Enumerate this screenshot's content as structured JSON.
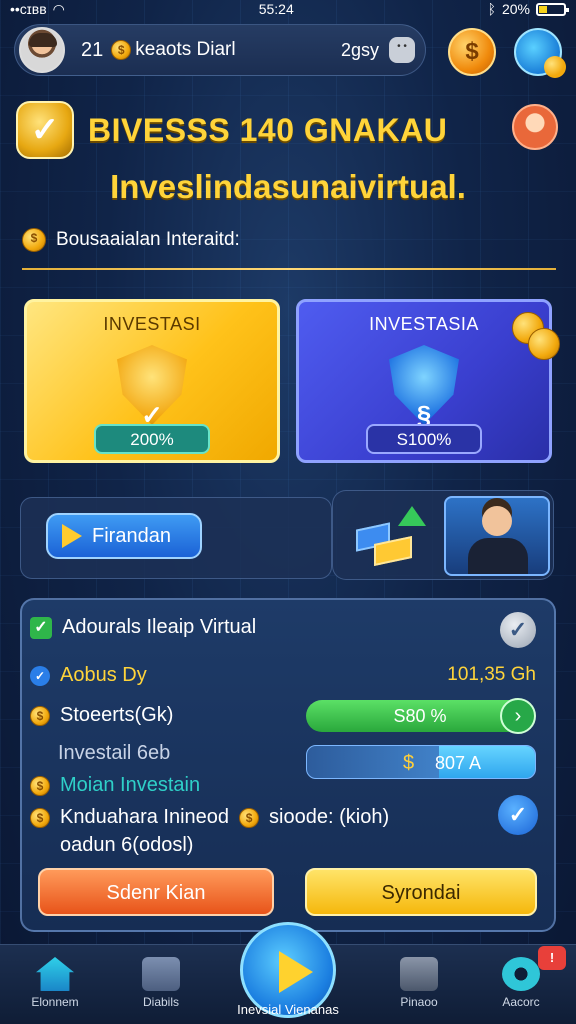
{
  "status_bar": {
    "carrier": "••ᴄɪʙʙ",
    "time": "55:24",
    "battery": "20%"
  },
  "header": {
    "level": "21",
    "name": "keaots Diarl",
    "amount": "2gsy"
  },
  "title": {
    "main": "BIVESSS 140 GNAKAU",
    "subtitle": "Inveslindasunaivirtual."
  },
  "section_label": "Bousaaialan Interaitd:",
  "cards": [
    {
      "title": "INVESTASI",
      "badge": "200%",
      "theme": "yellow"
    },
    {
      "title": "INVESTASIA",
      "badge": "S100%",
      "theme": "blue"
    }
  ],
  "promo": {
    "button_label": "Firandan"
  },
  "portfolio": {
    "header": "Adourals Ileaip Virtual",
    "row1_label": "Aobus Dy",
    "row1_amount": "101,35 Gh",
    "row2_label": "Stoeerts(Gk)",
    "row2_bar": "S80 %",
    "row2_progress": 0.8,
    "row3_label": "Investail 6eb",
    "row3_bar": "807 A",
    "row3_progress": 0.42,
    "row4_label": "Moian Investain",
    "row5_label_a": "Knduahara Inineod",
    "row5_label_b": "sioode: (kioh)",
    "row6_label": "oadun 6(odosl)",
    "btn_left": "Sdenr Kian",
    "btn_right": "Syrondai"
  },
  "nav": {
    "items": [
      "Elonnem",
      "Diabils",
      "Pinaoo",
      "Aacorc"
    ],
    "center_label": "Inevsial Vienanas",
    "badge": "!"
  },
  "colors": {
    "accent_gold": "#ffd43a",
    "accent_blue": "#1b7ee0",
    "panel": "#1e3b68"
  }
}
